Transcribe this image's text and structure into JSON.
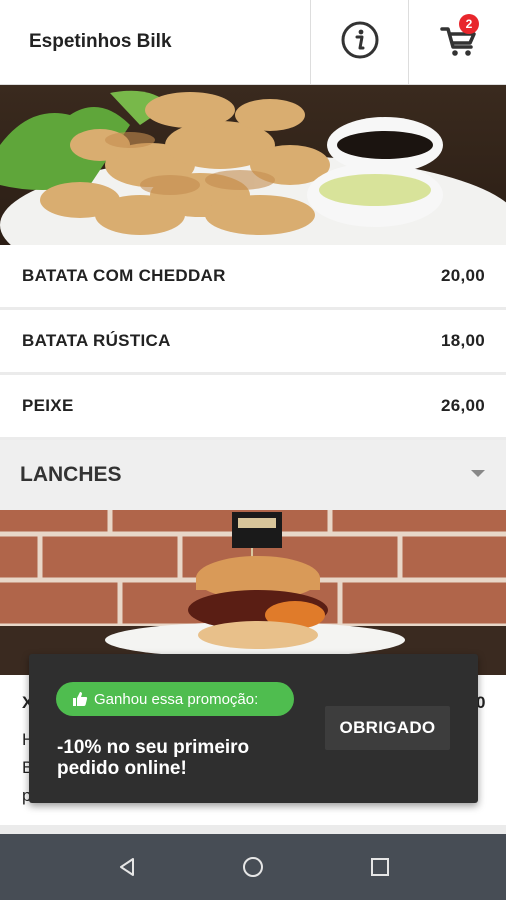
{
  "header": {
    "title": "Espetinhos Bilk",
    "cart_count": "2"
  },
  "menu_items": [
    {
      "name": "BATATA COM CHEDDAR",
      "price": "20,00"
    },
    {
      "name": "BATATA RÚSTICA",
      "price": "18,00"
    },
    {
      "name": "PEIXE",
      "price": "26,00"
    }
  ],
  "section": {
    "label": "LANCHES"
  },
  "burger_card": {
    "name_partial": "X",
    "desc_line1_partial": "H",
    "desc_line2_partial": "B",
    "desc_line3_partial": "p",
    "price_partial": "0"
  },
  "toast": {
    "promo_label": "Ganhou essa promoção:",
    "promo_text": "-10% no seu primeiro pedido online!",
    "ok_button": "OBRIGADO"
  },
  "icons": {
    "info": "info-icon",
    "cart": "cart-icon",
    "expand": "chevron-down-icon",
    "thumb": "thumb-up-icon",
    "back": "back-icon",
    "home": "home-icon",
    "recents": "recents-icon"
  },
  "colors": {
    "promo_green": "#4fbd4f",
    "badge_red": "#e8262c",
    "toast_bg": "#2f2f2f",
    "navbar_bg": "#474d55"
  }
}
